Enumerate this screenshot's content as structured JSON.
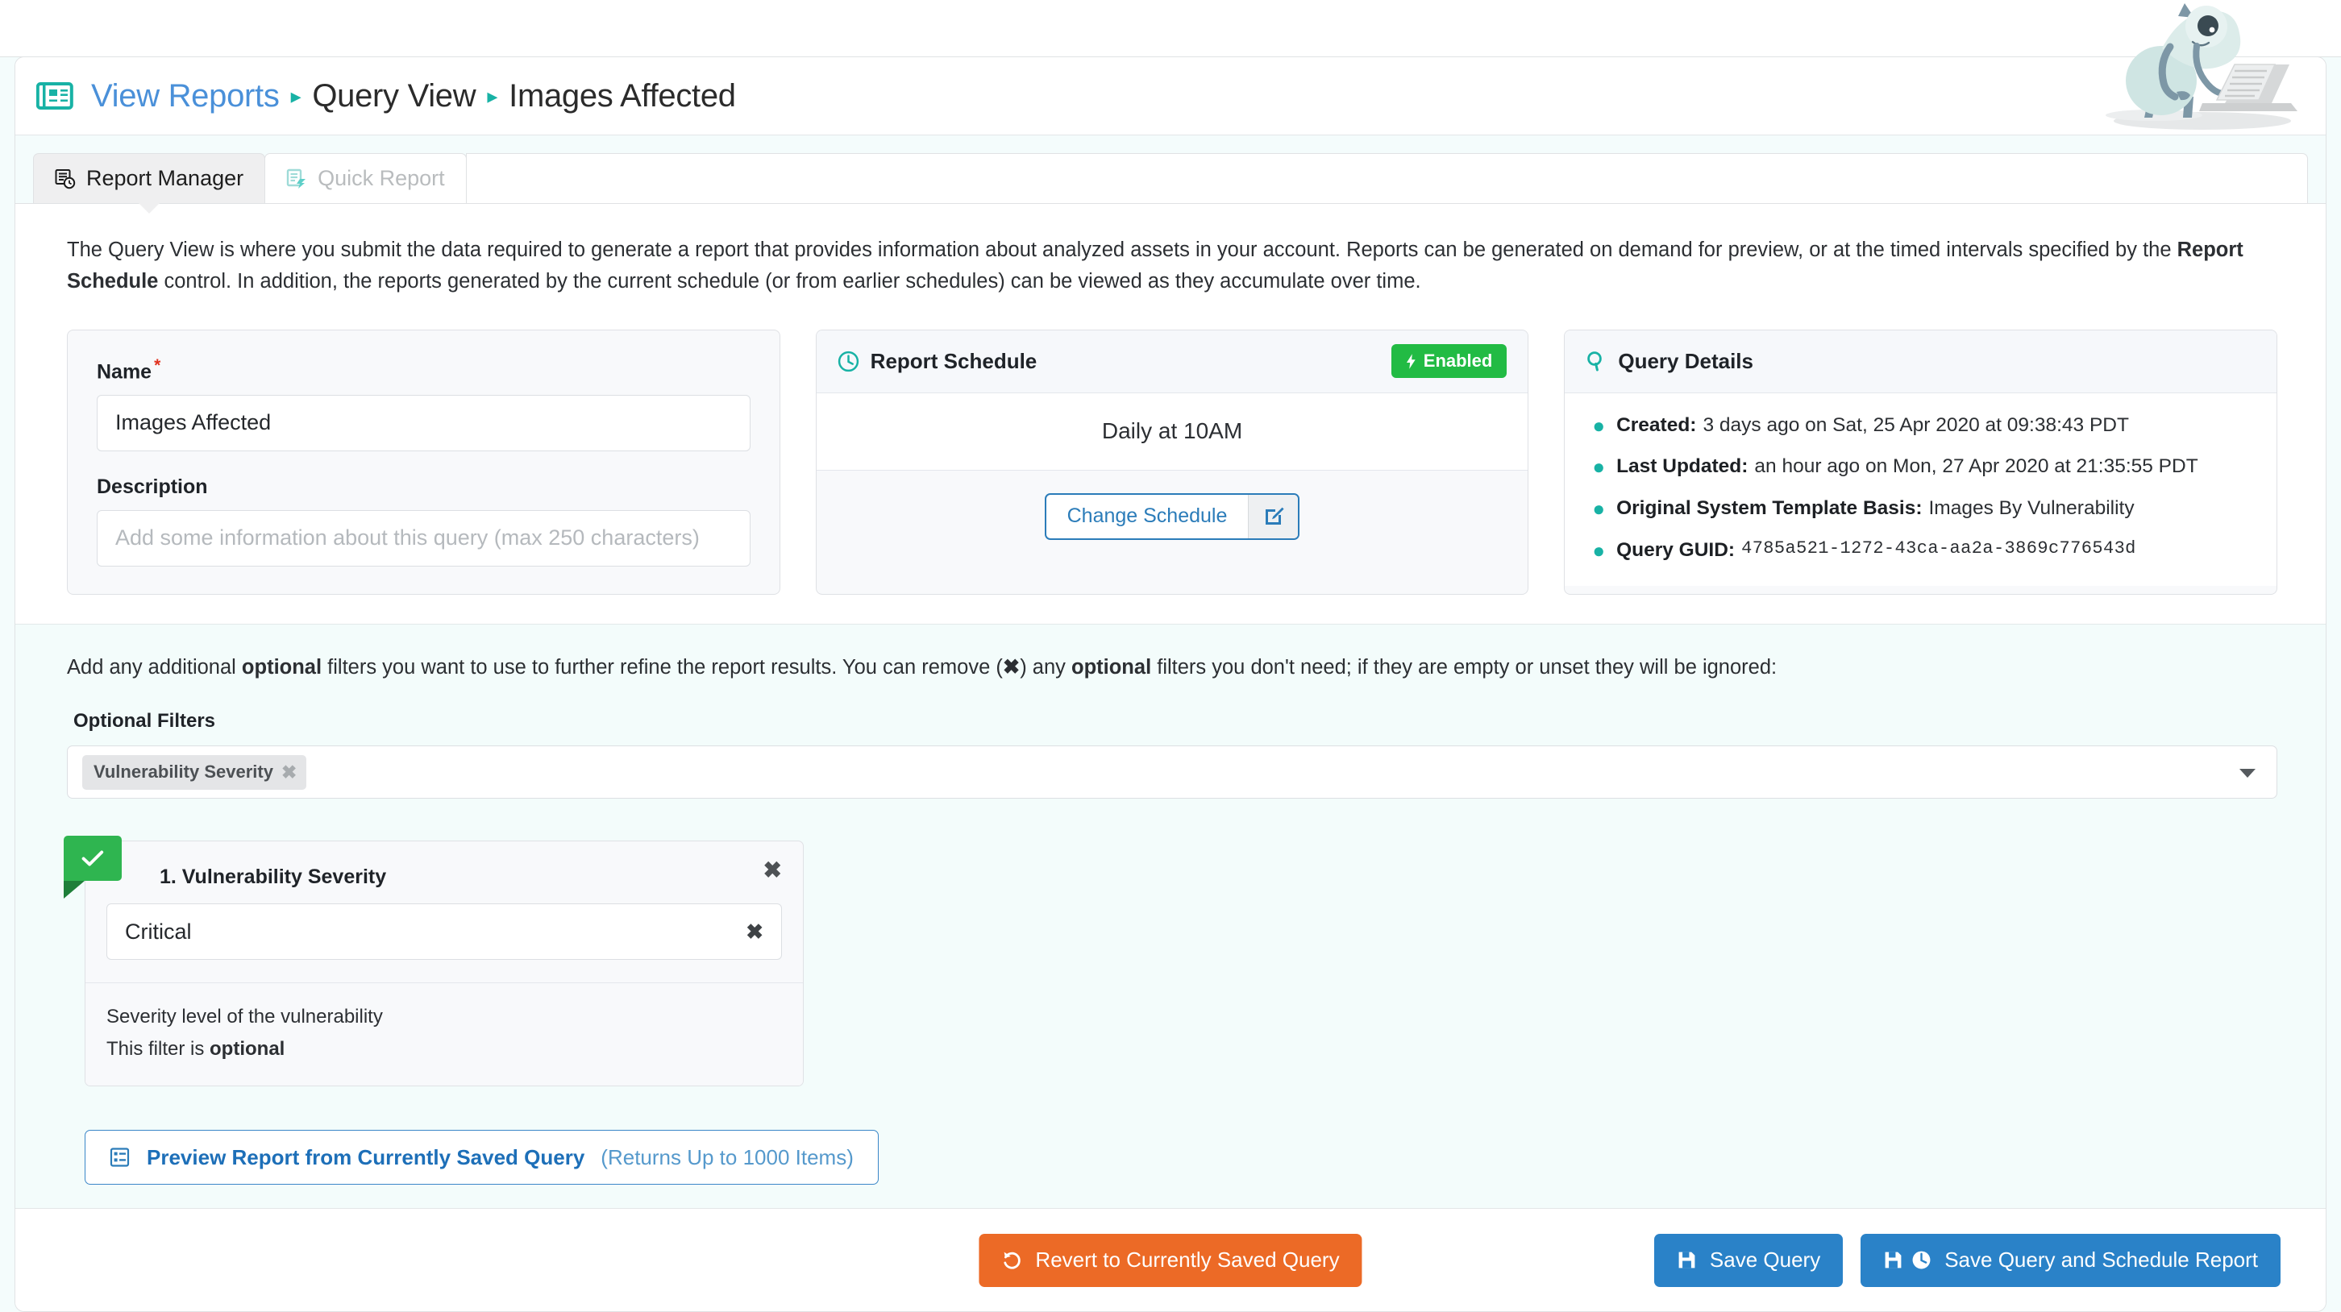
{
  "breadcrumb": {
    "icon": "newspaper-icon",
    "link": "View Reports",
    "sep": "▸",
    "mid": "Query View",
    "current": "Images Affected"
  },
  "tabs": [
    {
      "label": "Report Manager",
      "icon": "report-clock-icon",
      "active": true
    },
    {
      "label": "Quick Report",
      "icon": "quick-report-icon",
      "active": false
    }
  ],
  "intro": {
    "p1": "The Query View is where you submit the data required to generate a report that provides information about analyzed assets in your account. Reports can be generated on demand for preview, or at the timed intervals specified by the ",
    "b1": "Report Schedule",
    "p2": " control. In addition, the reports generated by the current schedule (or from earlier schedules) can be viewed as they accumulate over time."
  },
  "name_card": {
    "name_label": "Name",
    "required_mark": "*",
    "name_value": "Images Affected",
    "description_label": "Description",
    "description_value": "",
    "description_placeholder": "Add some information about this query (max 250 characters)"
  },
  "schedule_card": {
    "title": "Report Schedule",
    "icon": "clock-icon",
    "status_badge": "Enabled",
    "status_icon": "bolt-icon",
    "status_color": "#22bb44",
    "schedule_text": "Daily at 10AM",
    "change_button": "Change Schedule",
    "change_button_icon": "edit-pencil-icon"
  },
  "details_card": {
    "title": "Query Details",
    "icon": "search-icon",
    "items": [
      {
        "key": "Created:",
        "value": "3 days ago on Sat, 25 Apr 2020 at 09:38:43 PDT",
        "mono": false
      },
      {
        "key": "Last Updated:",
        "value": "an hour ago on Mon, 27 Apr 2020 at 21:35:55 PDT",
        "mono": false
      },
      {
        "key": "Original System Template Basis:",
        "value": "Images By Vulnerability",
        "mono": false
      },
      {
        "key": "Query GUID:",
        "value": "4785a521-1272-43ca-aa2a-3869c776543d",
        "mono": true
      }
    ]
  },
  "filters": {
    "intro_1": "Add any additional ",
    "intro_b1": "optional",
    "intro_2": " filters you want to use to further refine the report results. You can remove (",
    "intro_x": "✖",
    "intro_3": ") any ",
    "intro_b2": "optional",
    "intro_4": " filters you don't need; if they are empty or unset they will be ignored:",
    "section_label": "Optional Filters",
    "selected_chips": [
      {
        "label": "Vulnerability Severity",
        "remove_icon": "chip-remove-icon"
      }
    ],
    "dropdown_icon": "chevron-down-icon",
    "cards": [
      {
        "index_title": "1. Vulnerability Severity",
        "status_icon": "check-icon",
        "remove_icon": "close-icon",
        "value": "Critical",
        "clear_icon": "clear-icon",
        "help_text": "Severity level of the vulnerability",
        "optional_prefix": "This filter is ",
        "optional_word": "optional"
      }
    ]
  },
  "preview_button": {
    "icon": "list-report-icon",
    "strong_label": "Preview Report from Currently Saved Query",
    "soft_label": " (Returns Up to 1000 Items)"
  },
  "footer": {
    "revert_label": "Revert to Currently Saved Query",
    "revert_icon": "undo-icon",
    "revert_color": "#ec6a26",
    "save_label": "Save Query",
    "save_icon": "save-icon",
    "save_schedule_label": "Save Query and Schedule Report",
    "save_schedule_icon_1": "save-icon",
    "save_schedule_icon_2": "clock-icon",
    "save_color": "#2a82c8"
  },
  "mascot": {
    "name": "monster-with-laptop-mascot"
  }
}
